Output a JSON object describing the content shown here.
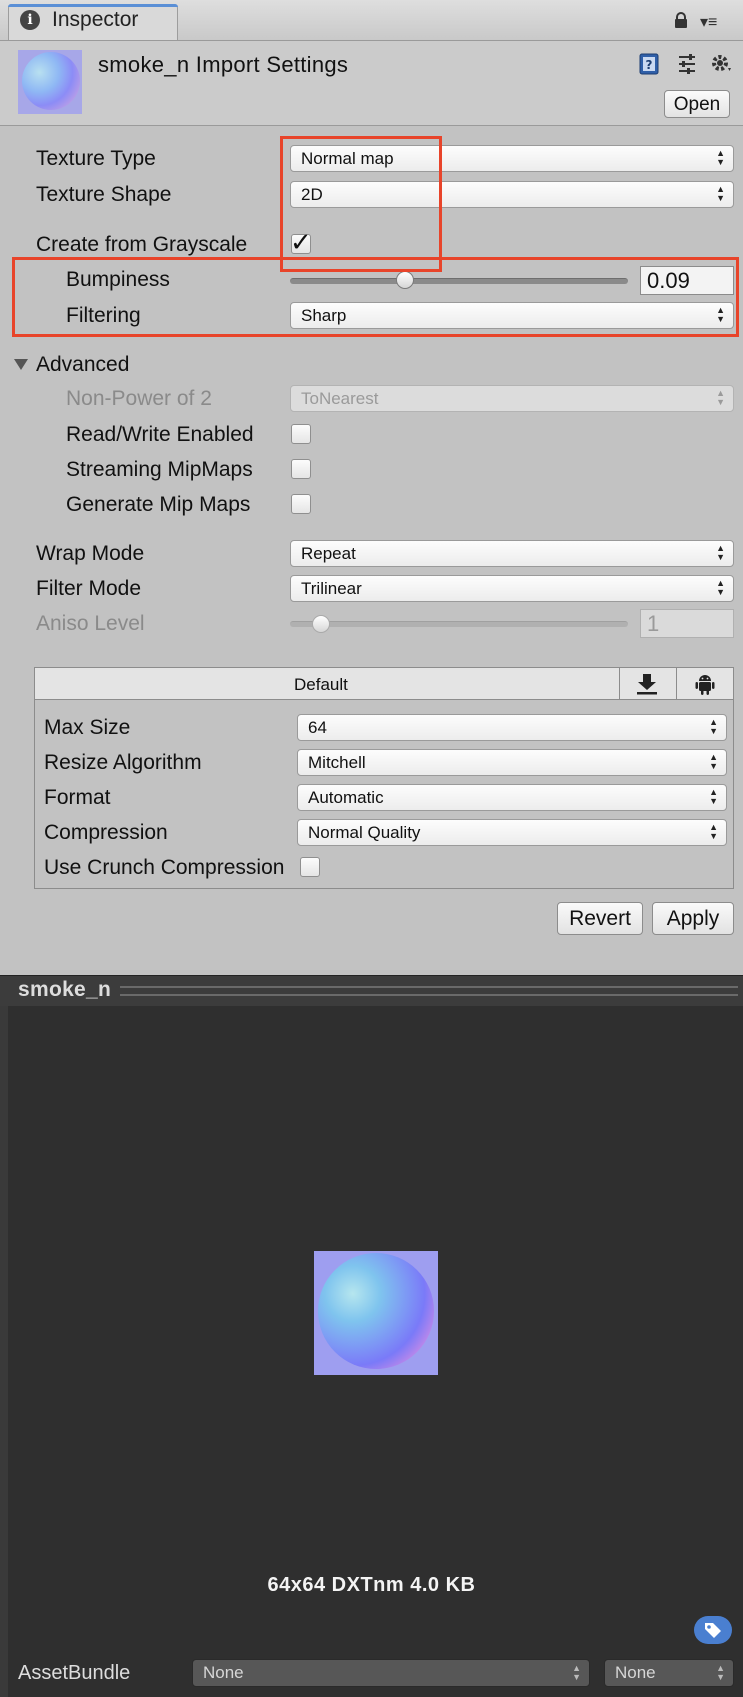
{
  "tab": {
    "label": "Inspector"
  },
  "header": {
    "title": "smoke_n Import Settings",
    "open_label": "Open"
  },
  "settings": {
    "texture_type": {
      "label": "Texture Type",
      "value": "Normal map"
    },
    "texture_shape": {
      "label": "Texture Shape",
      "value": "2D"
    },
    "create_from_grayscale": {
      "label": "Create from Grayscale",
      "checked": true
    },
    "bumpiness": {
      "label": "Bumpiness",
      "value": "0.09",
      "fraction": 0.33
    },
    "filtering": {
      "label": "Filtering",
      "value": "Sharp"
    }
  },
  "advanced": {
    "label": "Advanced",
    "non_power_of_2": {
      "label": "Non-Power of 2",
      "value": "ToNearest"
    },
    "read_write": {
      "label": "Read/Write Enabled",
      "checked": false
    },
    "streaming_mipmaps": {
      "label": "Streaming MipMaps",
      "checked": false
    },
    "generate_mipmaps": {
      "label": "Generate Mip Maps",
      "checked": false
    }
  },
  "wrap_mode": {
    "label": "Wrap Mode",
    "value": "Repeat"
  },
  "filter_mode": {
    "label": "Filter Mode",
    "value": "Trilinear"
  },
  "aniso_level": {
    "label": "Aniso Level",
    "value": "1",
    "fraction": 0.07
  },
  "platform": {
    "tab_label": "Default",
    "max_size": {
      "label": "Max Size",
      "value": "64"
    },
    "resize_algorithm": {
      "label": "Resize Algorithm",
      "value": "Mitchell"
    },
    "format": {
      "label": "Format",
      "value": "Automatic"
    },
    "compression": {
      "label": "Compression",
      "value": "Normal Quality"
    },
    "use_crunch": {
      "label": "Use Crunch Compression",
      "checked": false
    }
  },
  "actions": {
    "revert": "Revert",
    "apply": "Apply"
  },
  "preview": {
    "title": "smoke_n",
    "info": "64x64  DXTnm   4.0 KB"
  },
  "asset_bundle": {
    "label": "AssetBundle",
    "name": "None",
    "variant": "None"
  },
  "colors": {
    "highlight": "#e8442a",
    "tab_accent": "#5a8fd6",
    "tag": "#4a7fd0"
  }
}
